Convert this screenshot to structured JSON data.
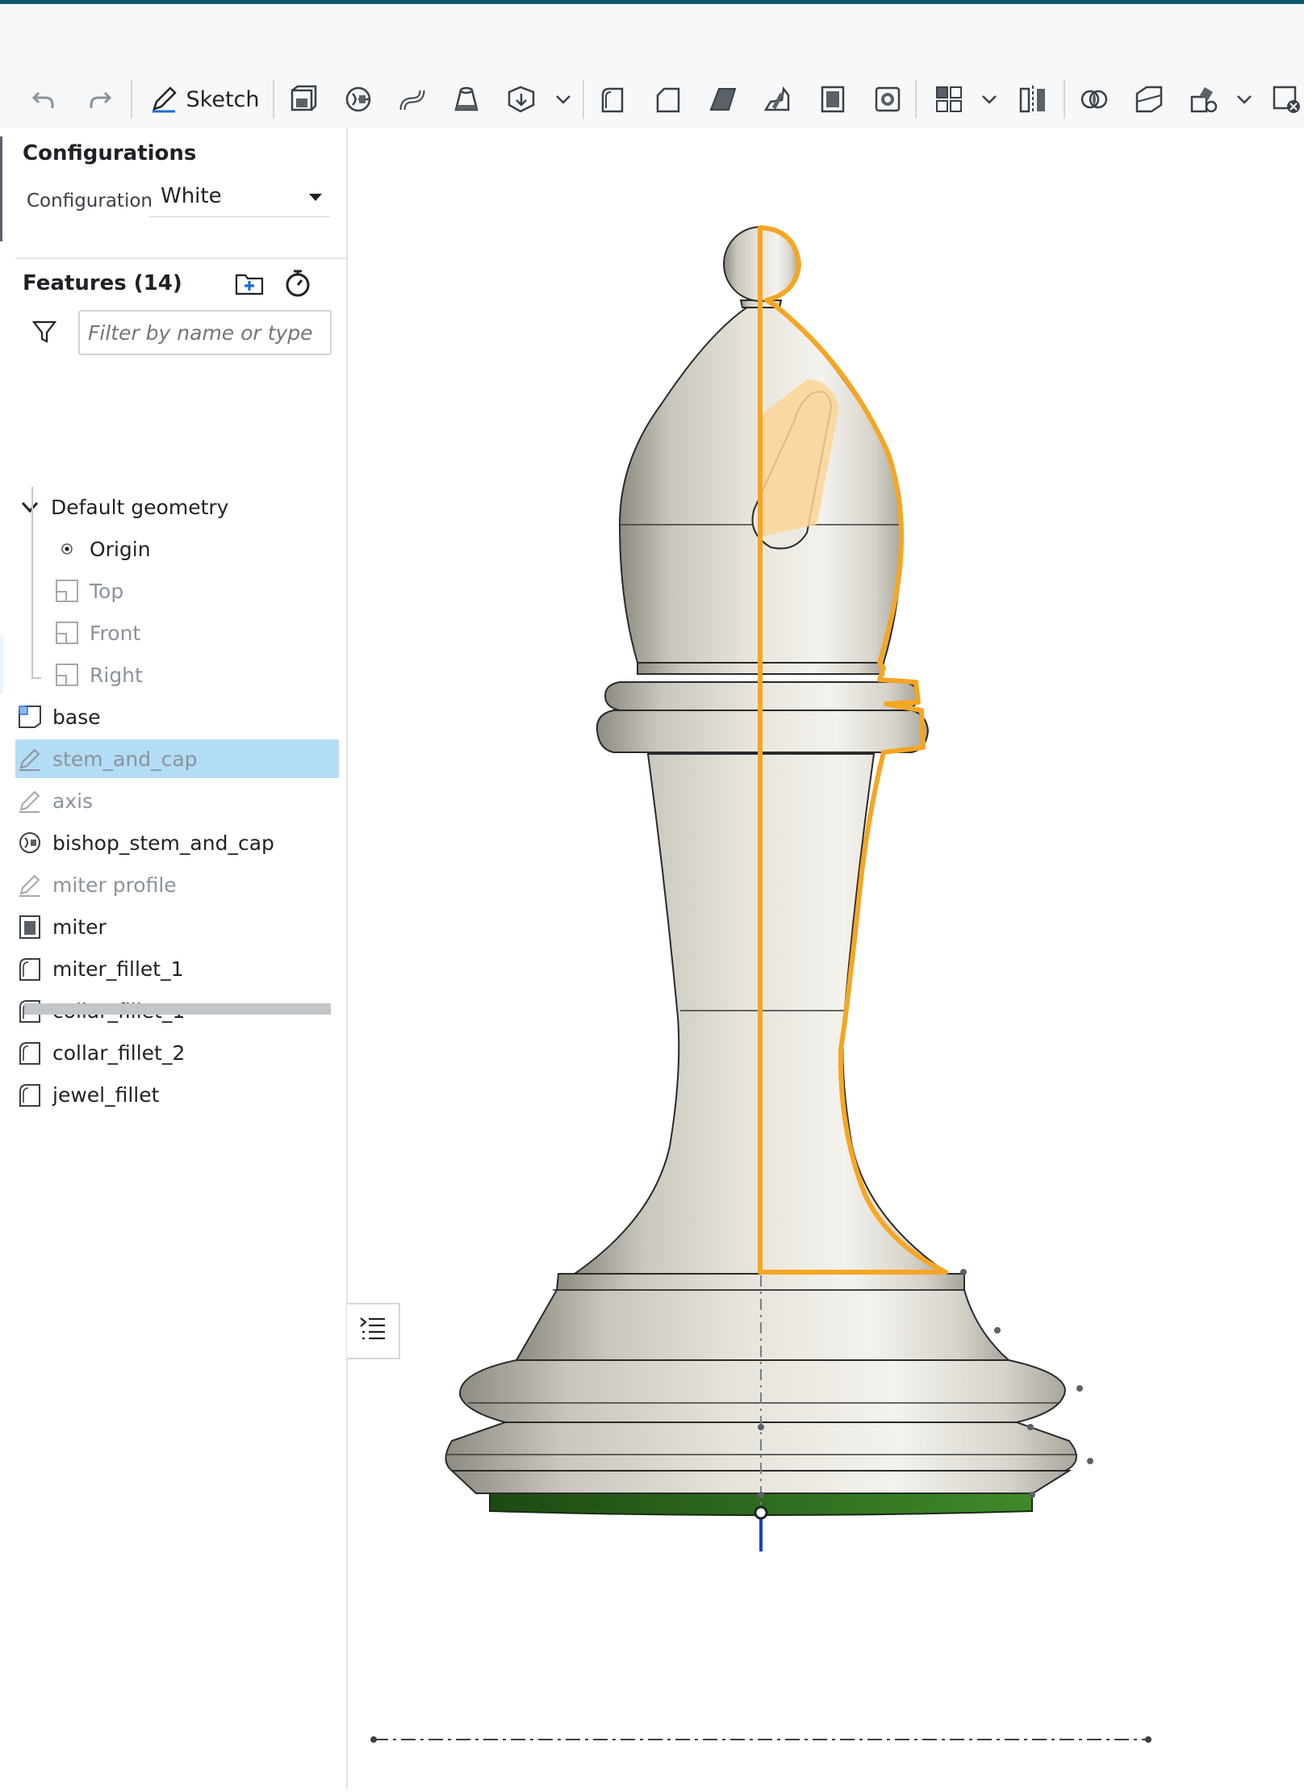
{
  "toolbar": {
    "sketch_label": "Sketch",
    "icons": [
      "undo-icon",
      "redo-icon",
      "sketch-icon",
      "extrude-icon",
      "revolve-icon",
      "sweep-icon",
      "loft-icon",
      "thicken-icon",
      "chevron-down-icon",
      "fillet-icon",
      "chamfer-icon",
      "draft-icon",
      "rib-icon",
      "shell-icon",
      "hole-icon",
      "pattern-icon",
      "chevron-down-icon",
      "mirror-icon",
      "boolean-icon",
      "split-icon",
      "transform-icon",
      "chevron-down-icon",
      "delete-part-icon"
    ]
  },
  "configurations": {
    "title": "Configurations",
    "label": "Configuration",
    "selected": "White"
  },
  "features": {
    "title": "Features (14)",
    "filter_placeholder": "Filter by name or type",
    "default_geometry": "Default geometry",
    "planes": [
      "Origin",
      "Top",
      "Front",
      "Right"
    ],
    "items": [
      {
        "label": "base",
        "icon": "extrude-icon",
        "dim": false,
        "selected": false
      },
      {
        "label": "stem_and_cap",
        "icon": "sketch-icon",
        "dim": true,
        "selected": true
      },
      {
        "label": "axis",
        "icon": "sketch-icon",
        "dim": true,
        "selected": false
      },
      {
        "label": "bishop_stem_and_cap",
        "icon": "revolve-icon",
        "dim": false,
        "selected": false
      },
      {
        "label": "miter profile",
        "icon": "sketch-icon",
        "dim": true,
        "selected": false
      },
      {
        "label": "miter",
        "icon": "shell-icon",
        "dim": false,
        "selected": false
      },
      {
        "label": "miter_fillet_1",
        "icon": "fillet-icon",
        "dim": false,
        "selected": false
      },
      {
        "label": "collar_fillet_1",
        "icon": "fillet-icon",
        "dim": false,
        "selected": false
      },
      {
        "label": "collar_fillet_2",
        "icon": "fillet-icon",
        "dim": false,
        "selected": false
      },
      {
        "label": "jewel_fillet",
        "icon": "fillet-icon",
        "dim": false,
        "selected": false
      }
    ]
  },
  "viewport": {
    "model": "bishop-chess-piece",
    "highlight_color": "#f5a623",
    "body_color": "#e0ddd5",
    "base_color": "#2e6b1f",
    "axis_color": "#1d3fbf"
  }
}
